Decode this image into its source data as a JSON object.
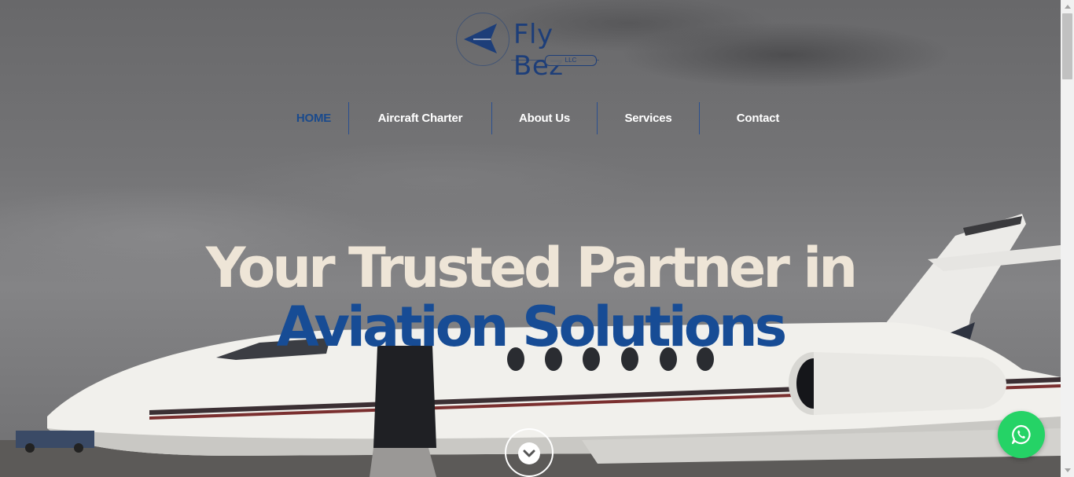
{
  "logo": {
    "name": "Fly Bez",
    "suffix": "LLC"
  },
  "nav": {
    "items": [
      {
        "label": "HOME",
        "active": true
      },
      {
        "label": "Aircraft Charter",
        "active": false
      },
      {
        "label": "About Us",
        "active": false
      },
      {
        "label": "Services",
        "active": false
      },
      {
        "label": "Contact",
        "active": false
      }
    ]
  },
  "hero": {
    "line1": "Your Trusted Partner in",
    "line2": "Aviation Solutions"
  },
  "icons": {
    "scroll": "chevron-down-icon",
    "whatsapp": "whatsapp-icon"
  },
  "colors": {
    "accent_blue": "#174c95",
    "headline_cream": "#eee5d7",
    "whatsapp_green": "#25d366"
  }
}
